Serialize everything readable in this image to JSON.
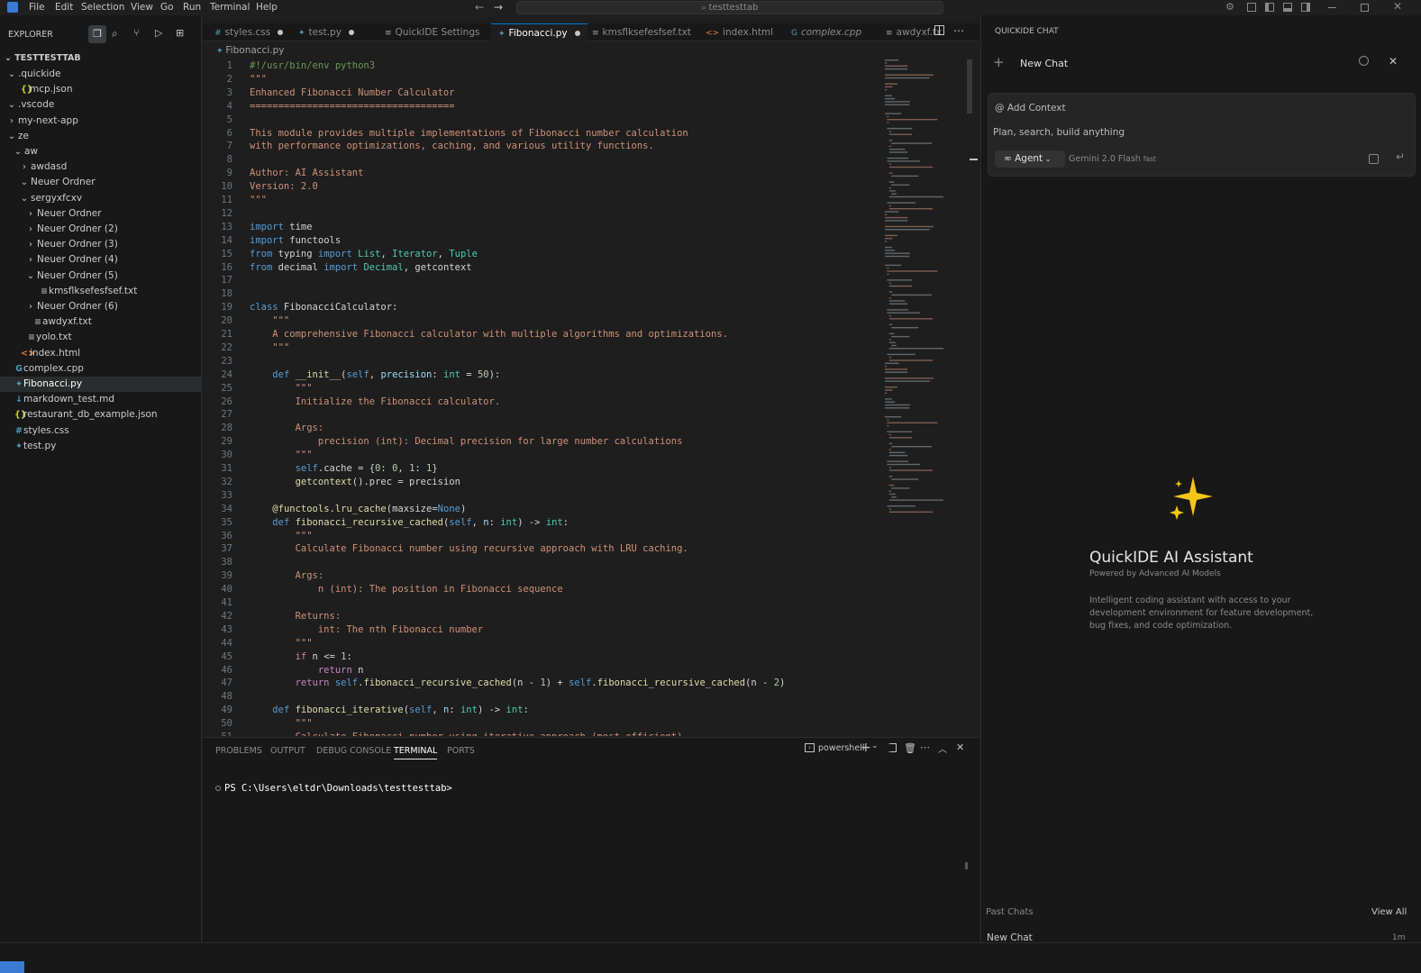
{
  "titlebar": {
    "menu": [
      "File",
      "Edit",
      "Selection",
      "View",
      "Go",
      "Run",
      "Terminal",
      "Help"
    ],
    "search": "testtesttab"
  },
  "explorer": {
    "title": "EXPLORER",
    "root": "TESTTESTTAB",
    "items": [
      {
        "label": ".quickide",
        "chev": "⌄",
        "icon": "",
        "indent": 0
      },
      {
        "label": "mcp.json",
        "chev": "",
        "icon": "{}",
        "indent": 1
      },
      {
        "label": ".vscode",
        "chev": "⌄",
        "icon": "",
        "indent": 0
      },
      {
        "label": "my-next-app",
        "chev": "›",
        "icon": "",
        "indent": 0
      },
      {
        "label": "ze",
        "chev": "⌄",
        "icon": "",
        "indent": 0
      },
      {
        "label": "aw",
        "chev": "⌄",
        "icon": "",
        "indent": 1
      },
      {
        "label": "awdasd",
        "chev": "›",
        "icon": "",
        "indent": 2
      },
      {
        "label": "Neuer Ordner",
        "chev": "⌄",
        "icon": "",
        "indent": 2
      },
      {
        "label": "sergyxfcxv",
        "chev": "⌄",
        "icon": "",
        "indent": 2
      },
      {
        "label": "Neuer Ordner",
        "chev": "›",
        "icon": "",
        "indent": 3
      },
      {
        "label": "Neuer Ordner (2)",
        "chev": "›",
        "icon": "",
        "indent": 3
      },
      {
        "label": "Neuer Ordner (3)",
        "chev": "›",
        "icon": "",
        "indent": 3
      },
      {
        "label": "Neuer Ordner (4)",
        "chev": "›",
        "icon": "",
        "indent": 3
      },
      {
        "label": "Neuer Ordner (5)",
        "chev": "⌄",
        "icon": "",
        "indent": 3
      },
      {
        "label": "kmsflksefesfsef.txt",
        "chev": "",
        "icon": "≡",
        "indent": 4
      },
      {
        "label": "Neuer Ordner (6)",
        "chev": "›",
        "icon": "",
        "indent": 3
      },
      {
        "label": "awdyxf.txt",
        "chev": "",
        "icon": "≡",
        "indent": 3
      },
      {
        "label": "yolo.txt",
        "chev": "",
        "icon": "≡",
        "indent": 2
      },
      {
        "label": "index.html",
        "chev": "",
        "icon": "<>",
        "indent": 1
      },
      {
        "label": "complex.cpp",
        "chev": "",
        "icon": "G",
        "indent": 0
      },
      {
        "label": "Fibonacci.py",
        "chev": "",
        "icon": "✦",
        "indent": 0
      },
      {
        "label": "markdown_test.md",
        "chev": "",
        "icon": "↓",
        "indent": 0
      },
      {
        "label": "restaurant_db_example.json",
        "chev": "",
        "icon": "{}",
        "indent": 0
      },
      {
        "label": "styles.css",
        "chev": "",
        "icon": "#",
        "indent": 0
      },
      {
        "label": "test.py",
        "chev": "",
        "icon": "✦",
        "indent": 0
      }
    ]
  },
  "tabs": [
    {
      "label": "styles.css",
      "icon": "#",
      "dirty": true
    },
    {
      "label": "test.py",
      "icon": "✦",
      "dirty": true
    },
    {
      "label": "QuickIDE Settings",
      "icon": "≡",
      "dirty": false
    },
    {
      "label": "Fibonacci.py",
      "icon": "✦",
      "dirty": true
    },
    {
      "label": "kmsflksefesfsef.txt",
      "icon": "≡",
      "dirty": false
    },
    {
      "label": "index.html",
      "icon": "<>",
      "dirty": false
    },
    {
      "label": "complex.cpp",
      "icon": "G",
      "dirty": false
    },
    {
      "label": "awdyxf.tx",
      "icon": "≡",
      "dirty": false
    }
  ],
  "breadcrumb": "Fibonacci.py",
  "code": [
    "#!/usr/bin/env python3",
    "\"\"\"",
    "Enhanced Fibonacci Number Calculator",
    "====================================",
    "",
    "This module provides multiple implementations of Fibonacci number calculation",
    "with performance optimizations, caching, and various utility functions.",
    "",
    "Author: AI Assistant",
    "Version: 2.0",
    "\"\"\"",
    "",
    "import time",
    "import functools",
    "from typing import List, Iterator, Tuple",
    "from decimal import Decimal, getcontext",
    "",
    "",
    "class FibonacciCalculator:",
    "    \"\"\"",
    "    A comprehensive Fibonacci calculator with multiple algorithms and optimizations.",
    "    \"\"\"",
    "",
    "    def __init__(self, precision: int = 50):",
    "        \"\"\"",
    "        Initialize the Fibonacci calculator.",
    "",
    "        Args:",
    "            precision (int): Decimal precision for large number calculations",
    "        \"\"\"",
    "        self.cache = {0: 0, 1: 1}",
    "        getcontext().prec = precision",
    "",
    "    @functools.lru_cache(maxsize=None)",
    "    def fibonacci_recursive_cached(self, n: int) -> int:",
    "        \"\"\"",
    "        Calculate Fibonacci number using recursive approach with LRU caching.",
    "",
    "        Args:",
    "            n (int): The position in Fibonacci sequence",
    "",
    "        Returns:",
    "            int: The nth Fibonacci number",
    "        \"\"\"",
    "        if n <= 1:",
    "            return n",
    "        return self.fibonacci_recursive_cached(n - 1) + self.fibonacci_recursive_cached(n - 2)",
    "",
    "    def fibonacci_iterative(self, n: int) -> int:",
    "        \"\"\"",
    "        Calculate Fibonacci number using iterative approach (most efficient)."
  ],
  "panel": {
    "tabs": [
      "PROBLEMS",
      "OUTPUT",
      "DEBUG CONSOLE",
      "TERMINAL",
      "PORTS"
    ],
    "active_tab": "TERMINAL",
    "shell": "powershell",
    "prompt": "PS C:\\Users\\eltdr\\Downloads\\testtesttab>"
  },
  "chat": {
    "title": "QUICKIDE CHAT",
    "header": "New Chat",
    "add_context": "@ Add Context",
    "placeholder": "Plan, search, build anything",
    "mode": "Agent",
    "model": "Gemini 2.0 Flash",
    "model_tag": "fast",
    "hero_title": "QuickIDE AI Assistant",
    "hero_subtitle": "Powered by Advanced AI Models",
    "hero_desc": "Intelligent coding assistant with access to your development environment for feature development, bug fixes, and code optimization.",
    "past_chats": "Past Chats",
    "view_all": "View All",
    "recent": [
      {
        "label": "New Chat",
        "time": "1m"
      }
    ]
  },
  "colors": {
    "keyword": "#569cd6",
    "control": "#c586c0",
    "function": "#dcdcaa",
    "string": "#ce9178",
    "comment": "#6a9955",
    "type": "#4ec9b0",
    "param": "#9cdcfe",
    "number": "#b5cea8",
    "accent": "#0078d4",
    "sparkle": "#f5c518"
  },
  "icons": {
    "explorer_actions": [
      "files-icon",
      "search-icon",
      "source-control-icon",
      "run-debug-icon",
      "extensions-icon"
    ],
    "title_right": [
      "settings-icon",
      "layout-icon",
      "toggle-sidebar-icon",
      "toggle-panel-icon",
      "toggle-secondary-icon",
      "minimize-icon",
      "maximize-icon",
      "close-icon"
    ]
  }
}
